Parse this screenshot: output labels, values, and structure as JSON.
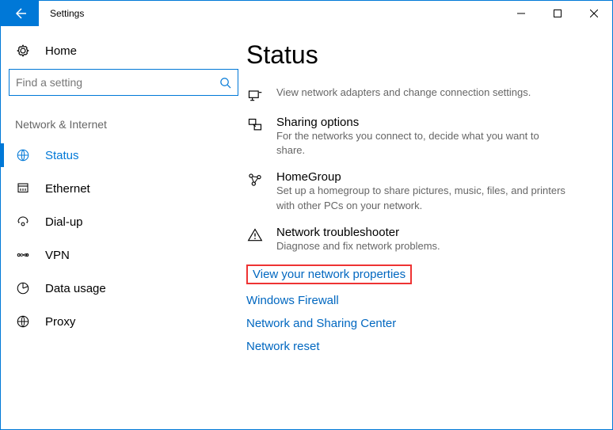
{
  "window": {
    "title": "Settings"
  },
  "home": {
    "label": "Home"
  },
  "search": {
    "placeholder": "Find a setting"
  },
  "section": {
    "title": "Network & Internet"
  },
  "nav": {
    "status": "Status",
    "ethernet": "Ethernet",
    "dialup": "Dial-up",
    "vpn": "VPN",
    "datausage": "Data usage",
    "proxy": "Proxy"
  },
  "page": {
    "heading": "Status",
    "adapter_desc": "View network adapters and change connection settings.",
    "sharing_title": "Sharing options",
    "sharing_desc": "For the networks you connect to, decide what you want to share.",
    "homegroup_title": "HomeGroup",
    "homegroup_desc": "Set up a homegroup to share pictures, music, files, and printers with other PCs on your network.",
    "troubleshooter_title": "Network troubleshooter",
    "troubleshooter_desc": "Diagnose and fix network problems.",
    "link_properties": "View your network properties",
    "link_firewall": "Windows Firewall",
    "link_sharingcenter": "Network and Sharing Center",
    "link_reset": "Network reset"
  }
}
